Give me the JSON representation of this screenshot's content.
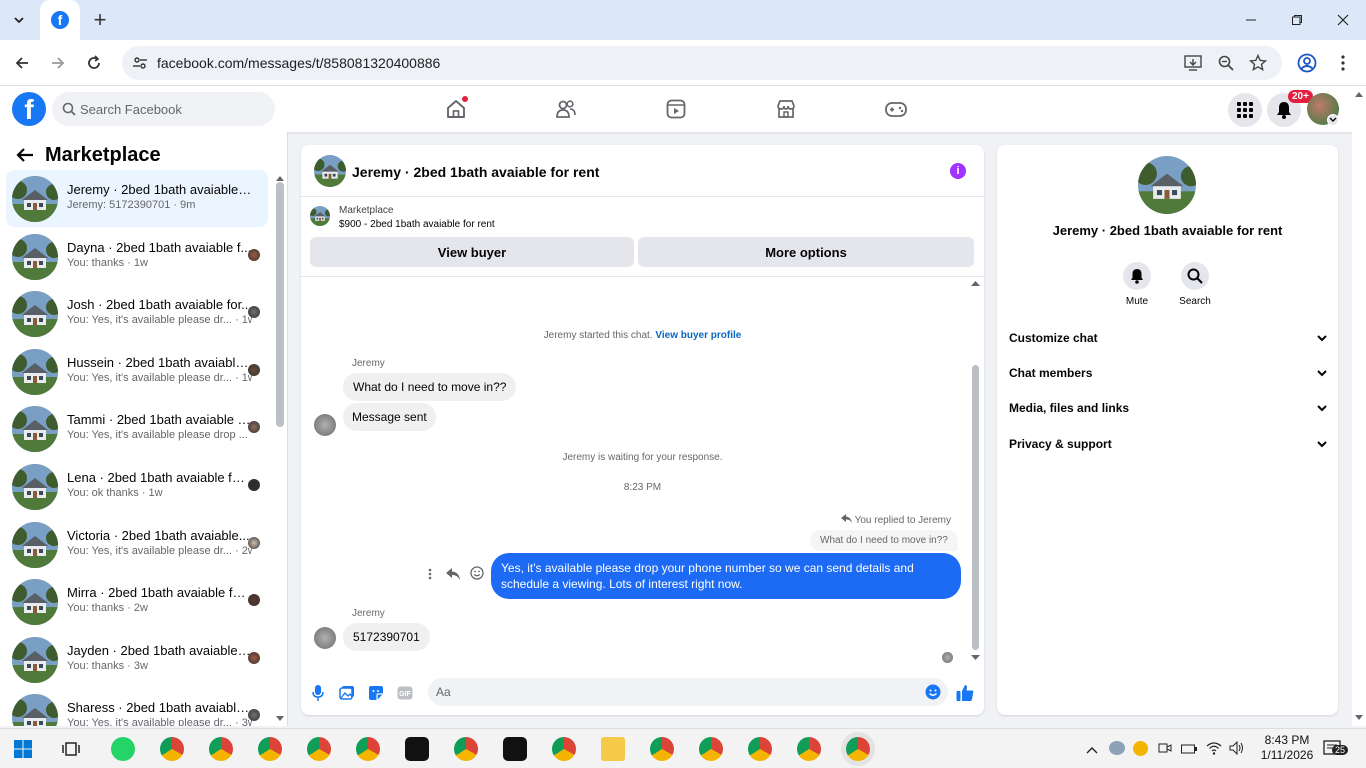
{
  "browser": {
    "tab_icon": "facebook-favicon",
    "url": "facebook.com/messages/t/858081320400886",
    "new_tab": "+"
  },
  "fb": {
    "logo": "f",
    "search_placeholder": "Search Facebook",
    "notif_badge": "20+"
  },
  "sidebar": {
    "title": "Marketplace",
    "conversations": [
      {
        "name": "Jeremy · 2bed 1bath avaiable fo...",
        "snippet": "Jeremy: 5172390701 · 9m",
        "active": true
      },
      {
        "name": "Dayna · 2bed 1bath avaiable f...",
        "snippet": "You: thanks · 1w"
      },
      {
        "name": "Josh · 2bed 1bath avaiable for...",
        "snippet": "You: Yes, it's available please dr... · 1w"
      },
      {
        "name": "Hussein · 2bed 1bath avaiable...",
        "snippet": "You: Yes, it's available please dr... · 1w"
      },
      {
        "name": "Tammi · 2bed 1bath avaiable for...",
        "snippet": "You: Yes, it's available please drop ... · 1w"
      },
      {
        "name": "Lena · 2bed 1bath avaiable for r...",
        "snippet": "You: ok thanks · 1w"
      },
      {
        "name": "Victoria · 2bed 1bath avaiable...",
        "snippet": "You: Yes, it's available please dr... · 2w"
      },
      {
        "name": "Mirra · 2bed 1bath avaiable for ...",
        "snippet": "You: thanks · 2w"
      },
      {
        "name": "Jayden · 2bed 1bath avaiable ...",
        "snippet": "You: thanks · 3w"
      },
      {
        "name": "Sharess · 2bed 1bath avaiable...",
        "snippet": "You: Yes, it's available please dr... · 3w"
      }
    ]
  },
  "chat": {
    "title": "Jeremy · 2bed 1bath avaiable for rent",
    "marketplace_label": "Marketplace",
    "listing": "$900 - 2bed 1bath avaiable for rent",
    "view_buyer": "View buyer",
    "more_options": "More options",
    "started_text": "Jeremy started this chat.",
    "view_profile": "View buyer profile",
    "sender1": "Jeremy",
    "msg1": "What do I need to move in??",
    "msg2": "Message sent",
    "waiting": "Jeremy is waiting for your response.",
    "time": "8:23 PM",
    "replied_to": "You replied to Jeremy",
    "quoted": "What do I need to move in??",
    "my_reply": "Yes, it's available please drop your phone number so we can send details and schedule a viewing. Lots of interest right now.",
    "sender2": "Jeremy",
    "msg3": "5172390701",
    "composer_placeholder": "Aa"
  },
  "rpanel": {
    "name": "Jeremy · 2bed 1bath avaiable for rent",
    "mute": "Mute",
    "search": "Search",
    "rows": [
      "Customize chat",
      "Chat members",
      "Media, files and links",
      "Privacy & support"
    ]
  },
  "taskbar": {
    "time": "8:43 PM",
    "date": "1/11/2026",
    "notif_count": "25"
  },
  "colors": {
    "fb_blue": "#1877f2",
    "my_bubble": "#1d6af5",
    "info_purple": "#a033ff"
  }
}
